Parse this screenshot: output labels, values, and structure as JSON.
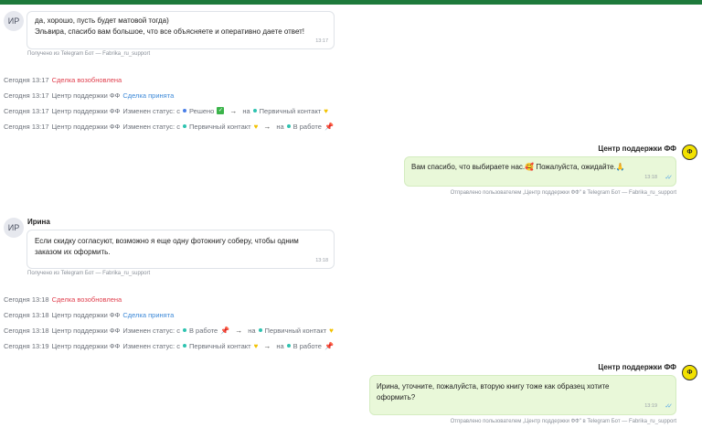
{
  "chat": {
    "messages": [
      {
        "avatar": "ИР",
        "lines": [
          "да, хорошо, пусть будет матовой тогда)",
          "Эльвира, спасибо вам большое, что все объясняете и оперативно даете ответ!"
        ],
        "time": "13:17",
        "meta": "Получено из Telegram Бот — Fabrika_ru_support"
      },
      {
        "author": "Центр поддержки ФФ",
        "text": "Вам спасибо, что выбираете нас.",
        "emoji1": "🥰",
        "text2": " Пожалуйста, ожидайте.",
        "emoji2": "🙏",
        "time": "13:18",
        "meta": "Отправлено пользователем „Центр поддержки ФФ\" в Telegram Бот — Fabrika_ru_support"
      },
      {
        "avatar": "ИР",
        "author": "Ирина",
        "lines": [
          "Если скидку согласуют, возможно я еще одну фотокнигу соберу, чтобы одним",
          "заказом их оформить."
        ],
        "time": "13:18",
        "meta": "Получено из Telegram Бот — Fabrika_ru_support"
      },
      {
        "author": "Центр поддержки ФФ",
        "lines": [
          "Ирина, уточните, пожалуйста, вторую книгу тоже как образец хотите",
          "оформить?"
        ],
        "time": "13:19",
        "meta": "Отправлено пользователем „Центр поддержки ФФ\" в Telegram Бот — Fabrika_ru_support"
      }
    ],
    "events_group1": [
      {
        "time": "Сегодня 13:17",
        "text": "Сделка возобновлена"
      },
      {
        "time": "Сегодня 13:17",
        "who": "Центр поддержки ФФ",
        "text": "Сделка принята"
      },
      {
        "time": "Сегодня 13:17",
        "who": "Центр поддержки ФФ",
        "change": "Изменен статус: с",
        "from": "Решено",
        "to_word": "на",
        "to": "Первичный контакт"
      },
      {
        "time": "Сегодня 13:17",
        "who": "Центр поддержки ФФ",
        "change": "Изменен статус: с",
        "from": "Первичный контакт",
        "to_word": "на",
        "to": "В работе"
      }
    ],
    "events_group2": [
      {
        "time": "Сегодня 13:18",
        "text": "Сделка возобновлена"
      },
      {
        "time": "Сегодня 13:18",
        "who": "Центр поддержки ФФ",
        "text": "Сделка принята"
      },
      {
        "time": "Сегодня 13:18",
        "who": "Центр поддержки ФФ",
        "change": "Изменен статус: с",
        "from": "В работе",
        "to_word": "на",
        "to": "Первичный контакт"
      },
      {
        "time": "Сегодня 13:19",
        "who": "Центр поддержки ФФ",
        "change": "Изменен статус: с",
        "from": "Первичный контакт",
        "to_word": "на",
        "to": "В работе"
      }
    ],
    "arrow": "→",
    "check_glyph": "✓✓",
    "colors": {
      "accent_green": "#1e7a3b",
      "out_bubble": "#e9f8d9",
      "red": "#e0414f",
      "blue": "#3e8ad8"
    }
  }
}
